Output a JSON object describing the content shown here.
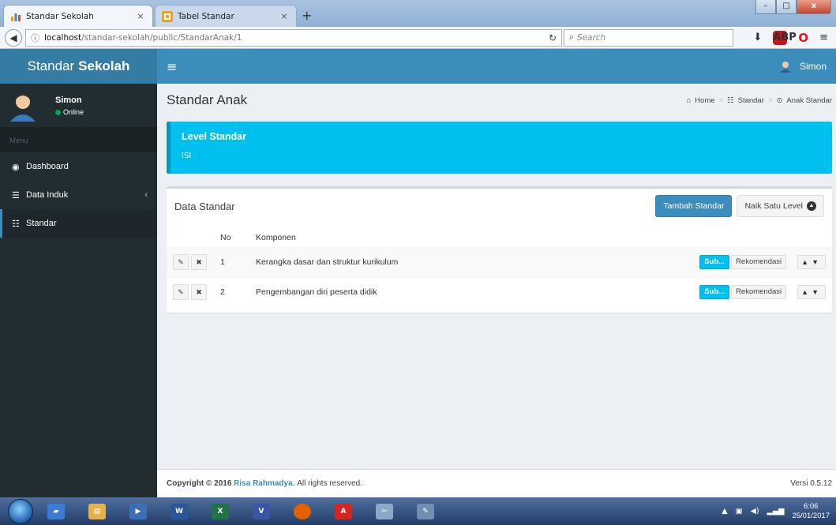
{
  "browser": {
    "tabs": [
      {
        "title": "Standar Sekolah",
        "close": "×"
      },
      {
        "title": "Tabel Standar",
        "close": "×"
      }
    ],
    "new_tab": "+",
    "window_buttons": {
      "minimize": "–",
      "maximize": "□",
      "close": "x"
    },
    "url_host": "localhost",
    "url_path": "/standar-sekolah/public/StandarAnak/1",
    "search_placeholder": "Search"
  },
  "header": {
    "logo_light": "Standar",
    "logo_bold": "Sekolah",
    "menu_toggle": "≡",
    "user_name": "Simon"
  },
  "sidebar": {
    "user_name": "Simon",
    "user_status": "Online",
    "menu_header": "Menu",
    "items": [
      {
        "label": "Dashboard",
        "icon": "dashboard-icon"
      },
      {
        "label": "Data Induk",
        "icon": "database-icon",
        "caret": "‹"
      },
      {
        "label": "Standar",
        "icon": "sliders-icon"
      }
    ]
  },
  "content": {
    "page_title": "Standar Anak",
    "breadcrumb": [
      "Home",
      "Standar",
      "Anak Standar"
    ],
    "callout_title": "Level Standar",
    "callout_body": "ISI",
    "box_title": "Data Standar",
    "btn_add": "Tambah Standar",
    "btn_up_level": "Naik Satu Level",
    "table": {
      "headers": {
        "no": "No",
        "komponen": "Komponen"
      },
      "rows": [
        {
          "no": "1",
          "komponen": "Kerangka dasar dan struktur kurikulum",
          "sub": "Sub...",
          "rekomendasi": "Rekomendasi"
        },
        {
          "no": "2",
          "komponen": "Pengembangan diri peserta didik",
          "sub": "Sub...",
          "rekomendasi": "Rekomendasi"
        }
      ]
    }
  },
  "footer": {
    "copyright": "Copyright © 2016",
    "author": "Risa Rahmadya.",
    "rights": "All rights reserved.",
    "version": "Versi 0.5.12"
  },
  "taskbar": {
    "time": "6:06",
    "date": "25/01/2017"
  },
  "colors": {
    "primary": "#3c8dbc",
    "logo_bg": "#357ca5",
    "sidebar_bg": "#222d32",
    "callout_bg": "#00c0ef",
    "online": "#00a65a"
  }
}
